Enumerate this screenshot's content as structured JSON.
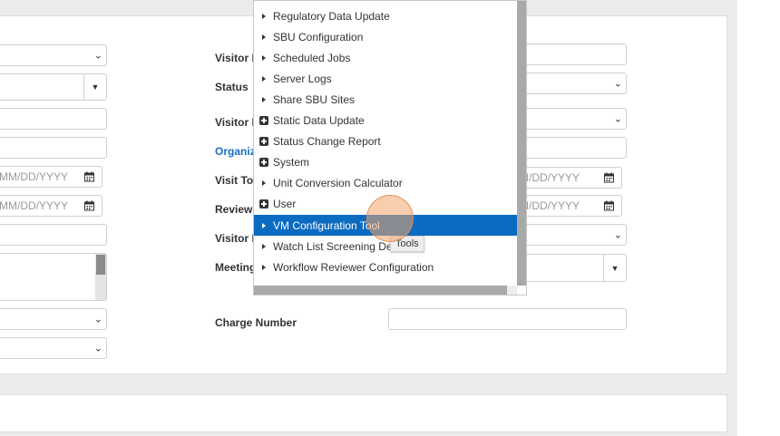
{
  "form": {
    "left_column": {
      "date_placeholder_1": "MM/DD/YYYY",
      "date_placeholder_2": "MM/DD/YYYY"
    },
    "labels": {
      "visitor_1": "Visitor F",
      "status": "Status",
      "visitor_2": "Visitor F",
      "organization": "Organiz",
      "visit_to": "Visit To",
      "review": "Review",
      "visitor_3": "Visitor D",
      "meeting": "Meeting",
      "charge_number": "Charge Number"
    },
    "right_column": {
      "date_placeholder_1": "MM/DD/YYYY",
      "date_placeholder_2": "MM/DD/YYYY"
    }
  },
  "dropdown": {
    "items": [
      {
        "label": "Regulatory Data Update",
        "icon": "triangle-right-icon"
      },
      {
        "label": "SBU Configuration",
        "icon": "triangle-right-icon"
      },
      {
        "label": "Scheduled Jobs",
        "icon": "triangle-right-icon"
      },
      {
        "label": "Server Logs",
        "icon": "triangle-right-icon"
      },
      {
        "label": "Share SBU Sites",
        "icon": "triangle-right-icon"
      },
      {
        "label": "Static Data Update",
        "icon": "plus-square-icon"
      },
      {
        "label": "Status Change Report",
        "icon": "plus-square-icon"
      },
      {
        "label": "System",
        "icon": "plus-square-icon"
      },
      {
        "label": "Unit Conversion Calculator",
        "icon": "triangle-right-icon"
      },
      {
        "label": "User",
        "icon": "plus-square-icon"
      },
      {
        "label": "VM Configuration Tool",
        "icon": "triangle-right-icon",
        "active": true
      },
      {
        "label": "Watch List Screening Def",
        "icon": "triangle-right-icon"
      },
      {
        "label": "Workflow Reviewer Configuration",
        "icon": "triangle-right-icon"
      }
    ]
  },
  "tooltip": {
    "text": "Tools"
  },
  "colors": {
    "accent": "#0b6bc1",
    "link": "#1a6fc4",
    "cursor": "#f2a66e"
  }
}
